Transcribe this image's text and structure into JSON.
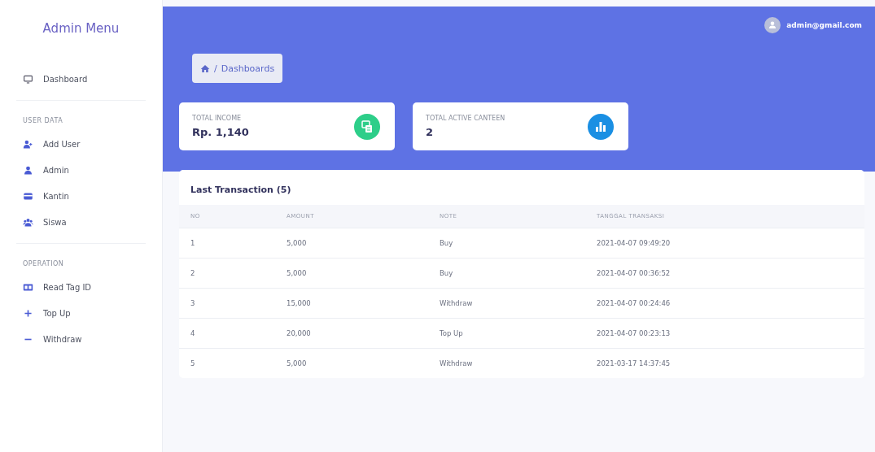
{
  "sidebar": {
    "title": "Admin Menu",
    "sections": [
      {
        "items": [
          {
            "label": "Dashboard",
            "kind": "monitor"
          }
        ]
      },
      {
        "heading": "USER DATA",
        "items": [
          {
            "label": "Add User",
            "kind": "user-plus"
          },
          {
            "label": "Admin",
            "kind": "user"
          },
          {
            "label": "Kantin",
            "kind": "card"
          },
          {
            "label": "Siswa",
            "kind": "users"
          }
        ]
      },
      {
        "heading": "OPERATION",
        "items": [
          {
            "label": "Read Tag ID",
            "kind": "id-card"
          },
          {
            "label": "Top Up",
            "kind": "plus"
          },
          {
            "label": "Withdraw",
            "kind": "minus"
          }
        ]
      }
    ]
  },
  "header": {
    "user": "admin@gmail.com"
  },
  "breadcrumb": {
    "separator": "/",
    "label": "Dashboards"
  },
  "stats": [
    {
      "label": "TOTAL INCOME",
      "value": "Rp. 1,140",
      "kind": "money",
      "color": "#2dce89"
    },
    {
      "label": "TOTAL ACTIVE CANTEEN",
      "value": "2",
      "kind": "chart",
      "color": "#1a8fe3"
    }
  ],
  "table": {
    "title": "Last Transaction (5)",
    "columns": [
      "NO",
      "AMOUNT",
      "NOTE",
      "TANGGAL TRANSAKSI"
    ],
    "rows": [
      [
        "1",
        "5,000",
        "Buy",
        "2021-04-07 09:49:20"
      ],
      [
        "2",
        "5,000",
        "Buy",
        "2021-04-07 00:36:52"
      ],
      [
        "3",
        "15,000",
        "Withdraw",
        "2021-04-07 00:24:46"
      ],
      [
        "4",
        "20,000",
        "Top Up",
        "2021-04-07 00:23:13"
      ],
      [
        "5",
        "5,000",
        "Withdraw",
        "2021-03-17 14:37:45"
      ]
    ]
  }
}
